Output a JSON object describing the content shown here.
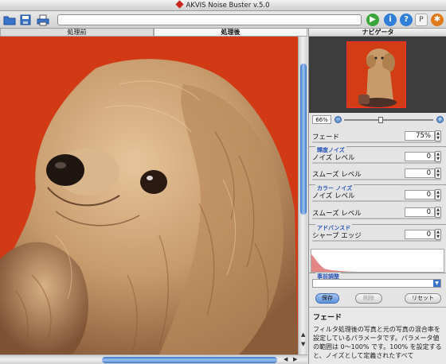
{
  "window": {
    "title": "AKVIS Noise Buster v.5.0"
  },
  "tabs": {
    "before": "処理前",
    "after": "処理後"
  },
  "navigator": {
    "title": "ナビゲータ",
    "zoom": "66%"
  },
  "fade": {
    "label": "フェード",
    "value": "75%"
  },
  "luminance_noise": {
    "title": "輝度ノイズ",
    "noise_label": "ノイズ レベル",
    "noise_value": "0",
    "smooth_label": "スムーズ レベル",
    "smooth_value": "0"
  },
  "color_noise": {
    "title": "カラー ノイズ",
    "noise_label": "ノイズ レベル",
    "noise_value": "0",
    "smooth_label": "スムーズ レベル",
    "smooth_value": "0"
  },
  "advanced": {
    "title": "アドバンスド",
    "sharp_label": "シャープ エッジ",
    "sharp_value": "0"
  },
  "presets": {
    "title": "事前調整",
    "save": "保存",
    "delete": "削除",
    "reset": "リセット"
  },
  "help": {
    "title": "フェード",
    "body": "フィルタ処理後の写真と元の写真の混合率を設定しているパラメータです。パラメータ値の範囲は 0～100% です。100% を設定すると、ノイズとして定義されたすべて"
  },
  "colors": {
    "accent": "#3a74c9",
    "background": "#d13a14",
    "section_title": "#2b55b8"
  }
}
